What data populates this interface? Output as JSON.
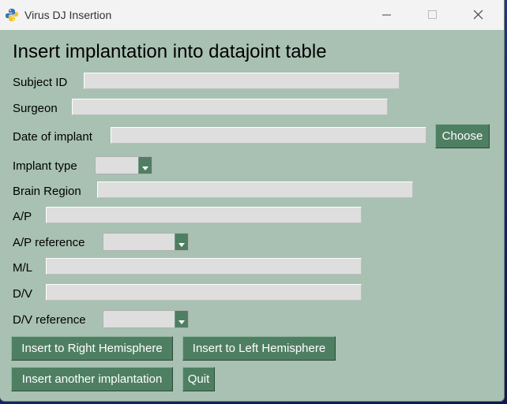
{
  "window": {
    "title": "Virus DJ Insertion"
  },
  "form": {
    "heading": "Insert implantation into datajoint table",
    "subject_id": {
      "label": "Subject ID",
      "value": ""
    },
    "surgeon": {
      "label": "Surgeon",
      "value": ""
    },
    "date_of_implant": {
      "label": "Date of implant",
      "value": "",
      "choose_label": "Choose"
    },
    "implant_type": {
      "label": "Implant type",
      "value": ""
    },
    "brain_region": {
      "label": "Brain Region",
      "value": ""
    },
    "ap": {
      "label": "A/P",
      "value": ""
    },
    "ap_reference": {
      "label": "A/P reference",
      "value": ""
    },
    "ml": {
      "label": "M/L",
      "value": ""
    },
    "dv": {
      "label": "D/V",
      "value": ""
    },
    "dv_reference": {
      "label": "D/V reference",
      "value": ""
    }
  },
  "buttons": {
    "insert_right": "Insert to Right Hemisphere",
    "insert_left": "Insert to Left Hemisphere",
    "insert_another": "Insert another implantation",
    "quit": "Quit"
  },
  "colors": {
    "background": "#a8c1b2",
    "button": "#4f7f62",
    "field": "#dedede"
  },
  "icons": {
    "app": "python-icon",
    "minimize": "minimize-icon",
    "maximize": "maximize-icon",
    "close": "close-icon",
    "dropdown": "chevron-down-icon"
  }
}
